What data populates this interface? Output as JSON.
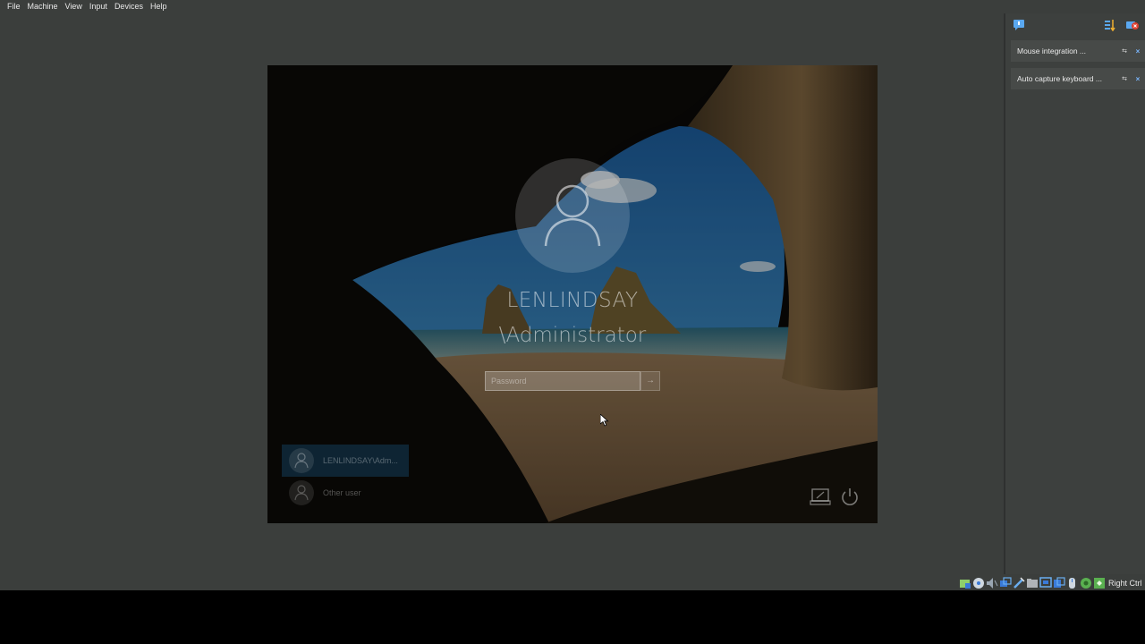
{
  "menubar": {
    "items": [
      "File",
      "Machine",
      "View",
      "Input",
      "Devices",
      "Help"
    ]
  },
  "guest_screen": {
    "username_line1": "LENLINDSAY",
    "username_line2": "\\Administrator",
    "password_placeholder": "Password",
    "submit_glyph": "→",
    "user_tiles": [
      {
        "label": "LENLINDSAY\\Adm...",
        "selected": true
      },
      {
        "label": "Other user",
        "selected": false
      }
    ],
    "icons": [
      "user-avatar-icon",
      "network-icon",
      "power-icon",
      "mouse-cursor-icon"
    ]
  },
  "notifications": {
    "items": [
      {
        "text": "Mouse integration ...",
        "pin_glyph": "⇆",
        "close_glyph": "×"
      },
      {
        "text": "Auto capture keyboard ...",
        "pin_glyph": "⇆",
        "close_glyph": "×"
      }
    ],
    "icons": [
      "message-icon",
      "sort-icon",
      "clear-all-icon"
    ]
  },
  "statusbar": {
    "icons": [
      "hard-disk-icon",
      "optical-drive-icon",
      "audio-icon",
      "network-adapter-icon",
      "usb-icon",
      "shared-folders-icon",
      "display-icon",
      "recording-icon",
      "mouse-integration-icon",
      "cpu-icon",
      "keyboard-capture-icon"
    ],
    "host_key_label": "Right Ctrl"
  },
  "colors": {
    "window_bg": "#3b3e3c",
    "panel_bg": "#3d403e",
    "notif_item_bg": "#474a48",
    "close_accent": "#7ab8ff"
  }
}
